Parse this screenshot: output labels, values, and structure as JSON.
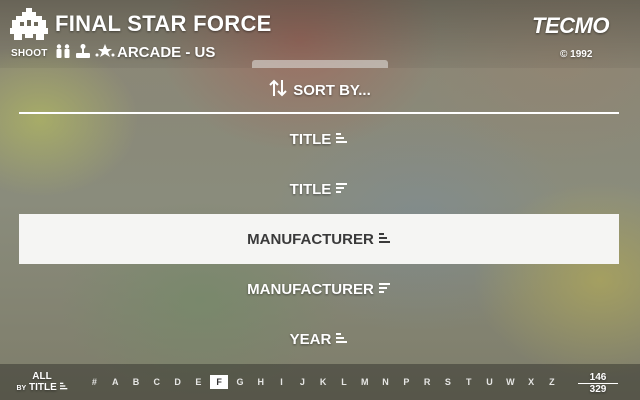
{
  "header": {
    "game_title": "FINAL STAR FORCE",
    "genre": "SHOOT",
    "platform": "ARCADE - US",
    "publisher": "TECMO",
    "copyright": "© 1992",
    "feature_icons": [
      "two-players-icon",
      "joystick-icon",
      "rating-icon"
    ]
  },
  "sort_menu": {
    "title": "SORT BY...",
    "items": [
      {
        "label": "TITLE",
        "order_icon": "sort-ascending-icon",
        "selected": false
      },
      {
        "label": "TITLE",
        "order_icon": "sort-descending-icon",
        "selected": false
      },
      {
        "label": "MANUFACTURER",
        "order_icon": "sort-ascending-icon",
        "selected": true
      },
      {
        "label": "MANUFACTURER",
        "order_icon": "sort-descending-icon",
        "selected": false
      },
      {
        "label": "YEAR",
        "order_icon": "sort-ascending-icon",
        "selected": false
      }
    ]
  },
  "bottom_bar": {
    "filter_label": "ALL",
    "sort_label_prefix": "BY",
    "sort_label": "TITLE",
    "alphabet": [
      "#",
      "A",
      "B",
      "C",
      "D",
      "E",
      "F",
      "G",
      "H",
      "I",
      "J",
      "K",
      "L",
      "M",
      "N",
      "P",
      "R",
      "S",
      "T",
      "U",
      "W",
      "X",
      "Z"
    ],
    "active_letter": "F",
    "position": "146",
    "total": "329"
  },
  "colors": {
    "selected_row_bg": "#f5f5f3",
    "selected_row_text": "#3a3a3a",
    "text": "#ffffff"
  }
}
